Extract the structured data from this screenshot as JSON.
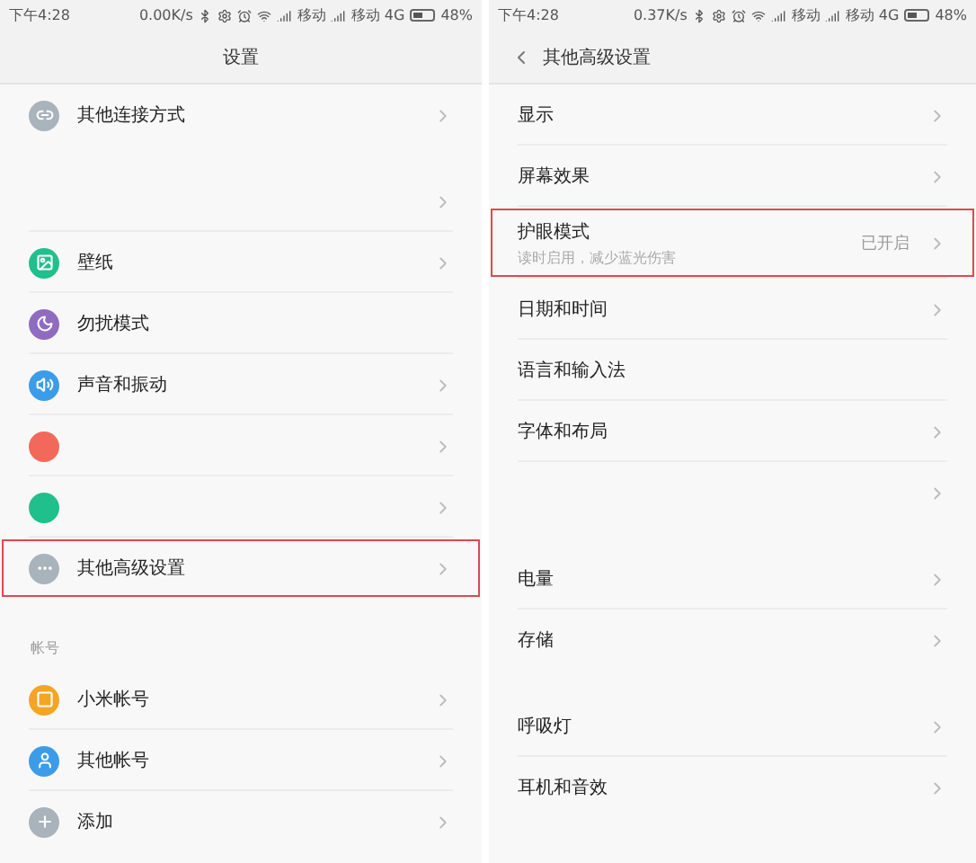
{
  "screens": [
    {
      "status_bar": {
        "time": "下午4:28",
        "speed": "0.00K/s",
        "carrier_1": "移动",
        "carrier_2": "移动 4G",
        "battery": "48%"
      },
      "header": {
        "title": "设置",
        "back": false
      },
      "groups": [
        {
          "rows": [
            {
              "label": "其他连接方式",
              "color": "#a9b3bc",
              "chevron": true,
              "highlighted": false
            }
          ]
        },
        {
          "rows": [
            {
              "chevron": true,
              "highlighted": false
            },
            {
              "label": "壁纸",
              "color": "#1fc08c",
              "chevron": true,
              "highlighted": false
            },
            {
              "label": "勿扰模式",
              "color": "#8f6cc0",
              "chevron": false,
              "highlighted": false
            },
            {
              "label": "声音和振动",
              "color": "#3d9ce8",
              "chevron": true,
              "highlighted": false
            },
            {
              "color": "#f2695c",
              "chevron": true,
              "highlighted": false
            },
            {
              "color": "#1fc08c",
              "chevron": true,
              "highlighted": false
            },
            {
              "label": "其他高级设置",
              "color": "#a9b3bc",
              "chevron": true,
              "highlighted": true
            }
          ]
        },
        {
          "title": "帐号",
          "rows": [
            {
              "label": "小米帐号",
              "color": "#f5a524",
              "chevron": true,
              "highlighted": false
            },
            {
              "label": "其他帐号",
              "color": "#3d9ce8",
              "chevron": true,
              "highlighted": false
            },
            {
              "label": "添加",
              "color": "#a9b3bc",
              "chevron": true,
              "highlighted": false
            }
          ]
        }
      ]
    },
    {
      "status_bar": {
        "time": "下午4:28",
        "speed": "0.37K/s",
        "carrier_1": "移动",
        "carrier_2": "移动 4G",
        "battery": "48%"
      },
      "header": {
        "title": "其他高级设置",
        "back": true
      },
      "groups": [
        {
          "rows": [
            {
              "label": "显示",
              "chevron": true,
              "highlighted": false
            },
            {
              "label": "屏幕效果",
              "chevron": true,
              "highlighted": false
            },
            {
              "label": "护眼模式",
              "subtitle": "读时启用，减少蓝光伤害",
              "value": "已开启",
              "chevron": true,
              "highlighted": true
            },
            {
              "label": "日期和时间",
              "chevron": true,
              "highlighted": false
            },
            {
              "label": "语言和输入法",
              "chevron": false,
              "highlighted": false
            },
            {
              "label": "字体和布局",
              "chevron": true,
              "highlighted": false
            },
            {
              "chevron": true,
              "highlighted": false
            }
          ]
        },
        {
          "rows": [
            {
              "label": "电量",
              "chevron": true,
              "highlighted": false
            },
            {
              "label": "存储",
              "chevron": true,
              "highlighted": false
            }
          ]
        },
        {
          "rows": [
            {
              "label": "呼吸灯",
              "chevron": true,
              "highlighted": false
            },
            {
              "label": "耳机和音效",
              "chevron": true,
              "highlighted": false
            }
          ]
        }
      ]
    }
  ]
}
